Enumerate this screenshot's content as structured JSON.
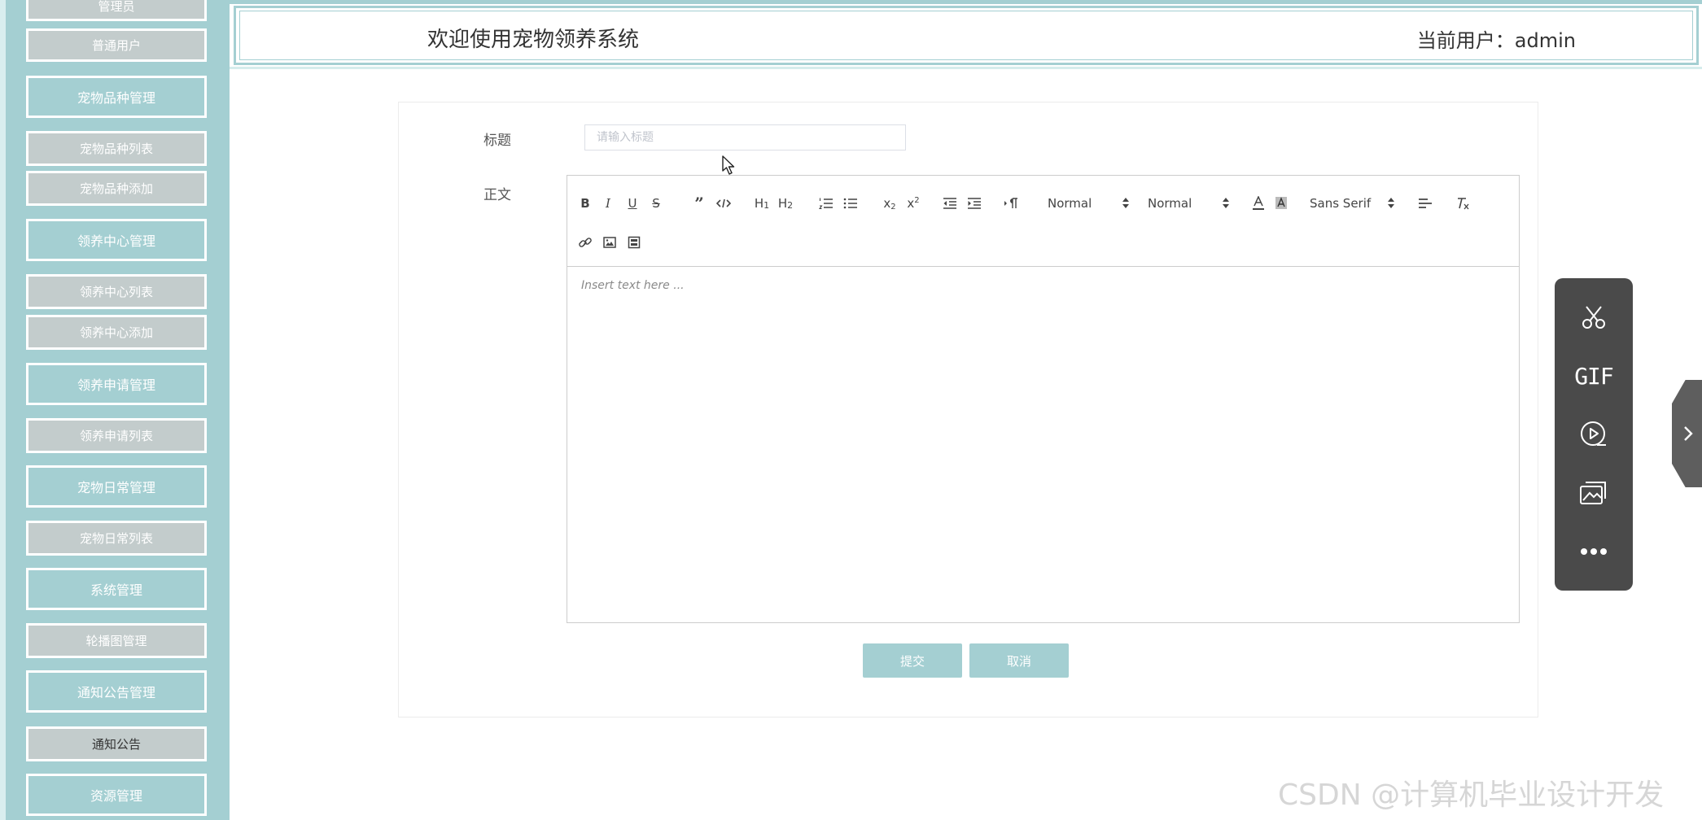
{
  "sidebar": {
    "items": [
      {
        "label": "管理员",
        "kind": "sub"
      },
      {
        "label": "普通用户",
        "kind": "sub"
      },
      {
        "label": "宠物品种管理",
        "kind": "group"
      },
      {
        "label": "宠物品种列表",
        "kind": "sub"
      },
      {
        "label": "宠物品种添加",
        "kind": "sub"
      },
      {
        "label": "领养中心管理",
        "kind": "group"
      },
      {
        "label": "领养中心列表",
        "kind": "sub"
      },
      {
        "label": "领养中心添加",
        "kind": "sub"
      },
      {
        "label": "领养申请管理",
        "kind": "group"
      },
      {
        "label": "领养申请列表",
        "kind": "sub"
      },
      {
        "label": "宠物日常管理",
        "kind": "group"
      },
      {
        "label": "宠物日常列表",
        "kind": "sub"
      },
      {
        "label": "系统管理",
        "kind": "group"
      },
      {
        "label": "轮播图管理",
        "kind": "sub"
      },
      {
        "label": "通知公告管理",
        "kind": "group"
      },
      {
        "label": "通知公告",
        "kind": "sub",
        "active": true
      },
      {
        "label": "资源管理",
        "kind": "group"
      }
    ]
  },
  "header": {
    "title": "欢迎使用宠物领养系统",
    "current_user": "当前用户：admin"
  },
  "form": {
    "title_label": "标题",
    "title_placeholder": "请输入标题",
    "title_value": "",
    "body_label": "正文",
    "editor": {
      "size_picker": "Normal",
      "header_picker": "Normal",
      "font_picker": "Sans Serif",
      "placeholder": "Insert text here ..."
    },
    "submit_label": "提交",
    "cancel_label": "取消"
  },
  "float_panel": {
    "gif_label": "GIF",
    "items": [
      "scissors-icon",
      "gif-icon",
      "record-icon",
      "gallery-icon",
      "more-icon"
    ]
  },
  "watermark": "CSDN @计算机毕业设计开发",
  "colors": {
    "accent": "#a4cfd2",
    "sub_item": "#c3cccc",
    "panel": "#4a4a4a"
  }
}
